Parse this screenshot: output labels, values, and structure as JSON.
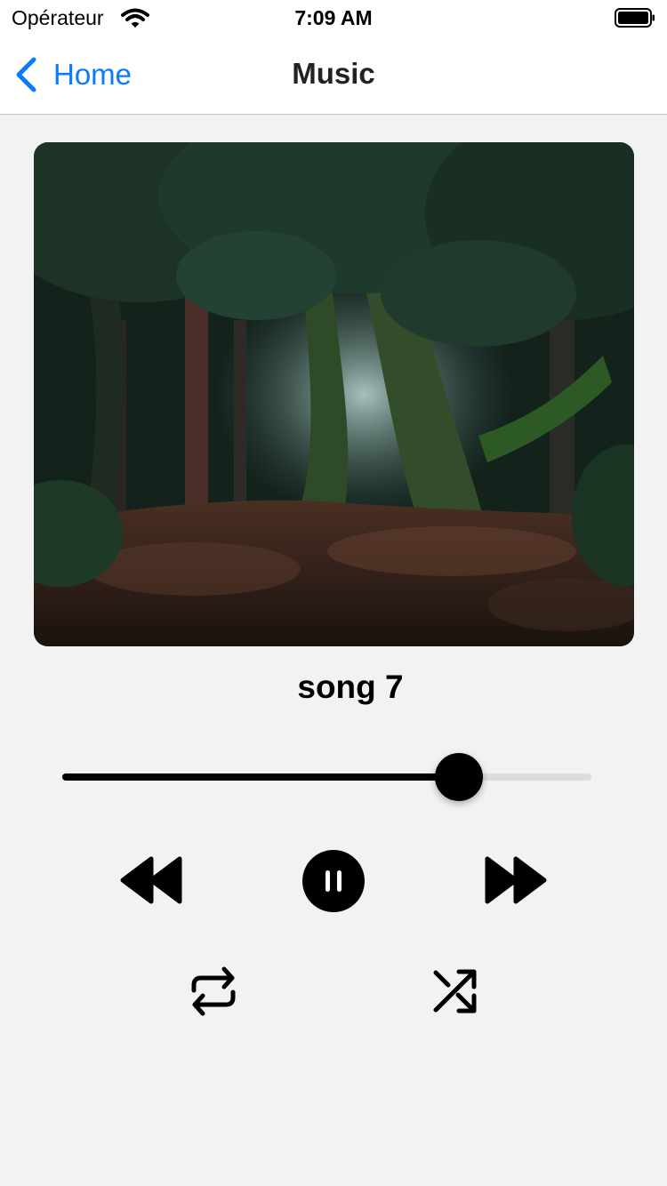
{
  "status_bar": {
    "carrier": "Opérateur",
    "time": "7:09 AM"
  },
  "nav": {
    "back_label": "Home",
    "title": "Music"
  },
  "player": {
    "song_title": "song 7",
    "progress": 0.75,
    "is_playing": true
  },
  "icons": {
    "back": "chevron-left-icon",
    "rewind": "rewind-icon",
    "pause": "pause-icon",
    "forward": "fast-forward-icon",
    "repeat": "repeat-icon",
    "shuffle": "shuffle-icon"
  },
  "colors": {
    "accent": "#0a7aff",
    "background": "#f2f2f2",
    "control": "#000000",
    "track": "#dcdcdc"
  }
}
